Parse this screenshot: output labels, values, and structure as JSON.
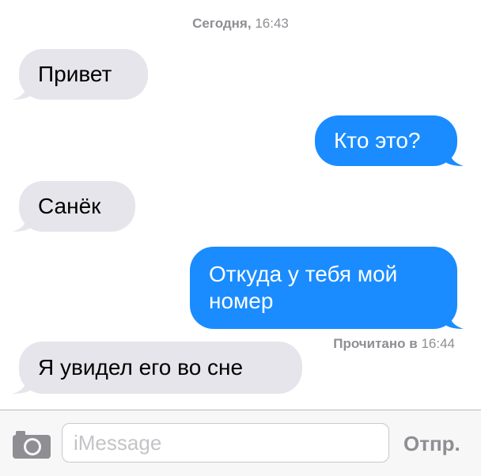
{
  "header": {
    "day": "Сегодня,",
    "time": "16:43"
  },
  "messages": [
    {
      "direction": "incoming",
      "text": "Привет"
    },
    {
      "direction": "outgoing",
      "text": "Кто это?"
    },
    {
      "direction": "incoming",
      "text": "Санёк"
    },
    {
      "direction": "outgoing",
      "text": "Откуда у тебя мой номер"
    },
    {
      "direction": "incoming",
      "text": "Я увидел его во сне"
    }
  ],
  "read_receipt": {
    "label": "Прочитано в",
    "time": "16:44"
  },
  "composer": {
    "placeholder": "iMessage",
    "send_label": "Отпр."
  },
  "colors": {
    "incoming_bubble": "#e6e5eb",
    "outgoing_bubble": "#1a8cff",
    "meta_text": "#8e8e93"
  },
  "icons": {
    "camera": "camera-icon"
  }
}
